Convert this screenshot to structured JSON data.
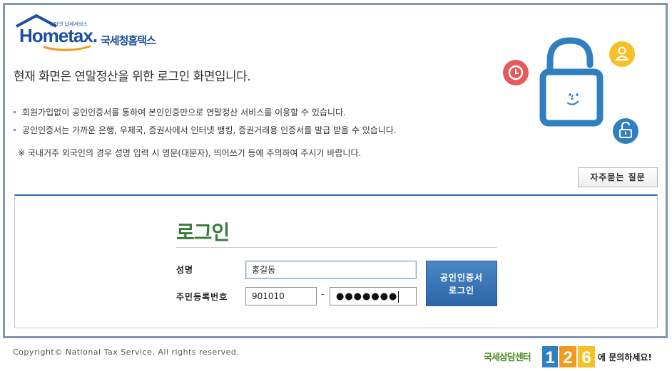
{
  "logo": {
    "subtitle": "인터넷 납세서비스",
    "brand_home": "Home",
    "brand_tax": "tax.",
    "brand_kr": "국세청홈택스"
  },
  "heading": "현재 화면은 연말정산을 위한 로그인 화면입니다.",
  "notes": [
    "회원가입없이 공인인증서를 통하여 본인인증만으로 연말정산 서비스를 이용할 수 있습니다.",
    "공인인증서는 가까운 은행, 우체국, 증권사에서 인터넷 뱅킹, 증권거래용 인증서를 발급 받을 수 있습니다."
  ],
  "warning": "※ 국내거주 외국인의 경우 성명 입력 시 영문(대문자), 띄어쓰기 등에 주의하여 주시기 바랍니다.",
  "faq_button": "자주묻는 질문",
  "login": {
    "title": "로그인",
    "name_label": "성명",
    "name_value": "홍길동",
    "rrn_label": "주민등록번호",
    "rrn_front": "901010",
    "rrn_separator": "-",
    "rrn_back_masked": "●●●●●●●",
    "cert_button_line1": "공인인증서",
    "cert_button_line2": "로그인"
  },
  "footer": {
    "copyright": "Copyright© National Tax Service. All rights reserved.",
    "callcenter_label": "국세상담센터",
    "callcenter_number": "126",
    "callcenter_suffix": "에 문의하세요!"
  },
  "colors": {
    "frame": "#8196b3",
    "brand_blue": "#1c4f9c",
    "login_green": "#3a7a3a",
    "button_blue": "#2d66a8",
    "icon_red": "#e35b5b",
    "icon_yellow": "#f6c026",
    "icon_blue": "#2f7fc1"
  },
  "icons": [
    "clock-icon",
    "user-icon",
    "unlock-icon",
    "open-padlock-illustration"
  ]
}
